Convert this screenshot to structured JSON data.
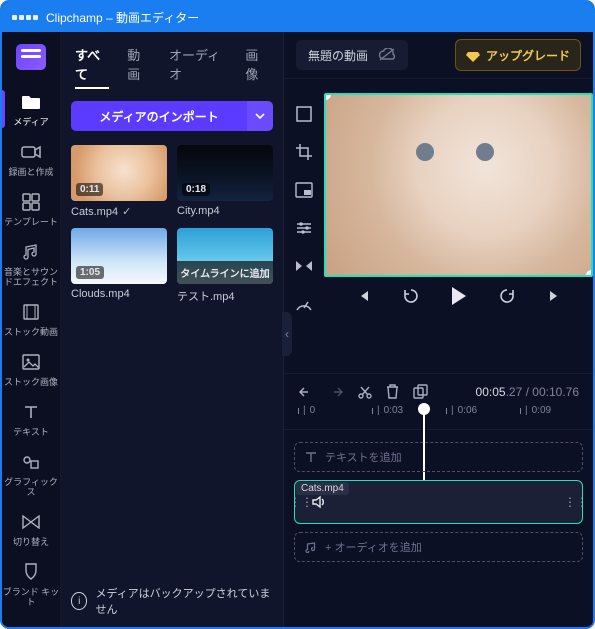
{
  "window": {
    "title": "Clipchamp – 動画エディター"
  },
  "rail": {
    "items": [
      {
        "label": "メディア"
      },
      {
        "label": "録画と作成"
      },
      {
        "label": "テンプレート"
      },
      {
        "label": "音楽とサウンドエフェクト"
      },
      {
        "label": "ストック動画"
      },
      {
        "label": "ストック画像"
      },
      {
        "label": "テキスト"
      },
      {
        "label": "グラフィックス"
      },
      {
        "label": "切り替え"
      },
      {
        "label": "ブランド キット"
      }
    ]
  },
  "panel": {
    "tabs": [
      "すべて",
      "動画",
      "オーディオ",
      "画像"
    ],
    "active_tab": 0,
    "import_label": "メディアのインポート",
    "media": [
      {
        "name": "Cats.mp4",
        "duration": "0:11",
        "checked": true,
        "bg": "bg-cats"
      },
      {
        "name": "City.mp4",
        "duration": "0:18",
        "checked": false,
        "bg": "bg-city"
      },
      {
        "name": "Clouds.mp4",
        "duration": "1:05",
        "checked": false,
        "bg": "bg-clouds"
      },
      {
        "name": "テスト.mp4",
        "duration": "",
        "checked": false,
        "bg": "bg-test",
        "overlay": "タイムラインに追加"
      }
    ],
    "footer": "メディアはバックアップされていません"
  },
  "topbar": {
    "project_title": "無題の動画",
    "upgrade": "アップグレード"
  },
  "preview": {
    "tools": [
      "fit-icon",
      "crop-icon",
      "pip-icon",
      "adjust-icon",
      "flip-icon",
      "speed-icon"
    ]
  },
  "timeline": {
    "timecode_current": "00:05",
    "timecode_current_frac": ".27",
    "timecode_total": "00:10",
    "timecode_total_frac": ".76",
    "ticks": [
      {
        "label": "0",
        "pos": 14
      },
      {
        "label": "0:03",
        "pos": 88
      },
      {
        "label": "0:06",
        "pos": 162
      },
      {
        "label": "0:09",
        "pos": 236
      }
    ],
    "text_track_placeholder": "テキストを追加",
    "clip_name": "Cats.mp4",
    "audio_track_placeholder": "+ オーディオを追加"
  }
}
